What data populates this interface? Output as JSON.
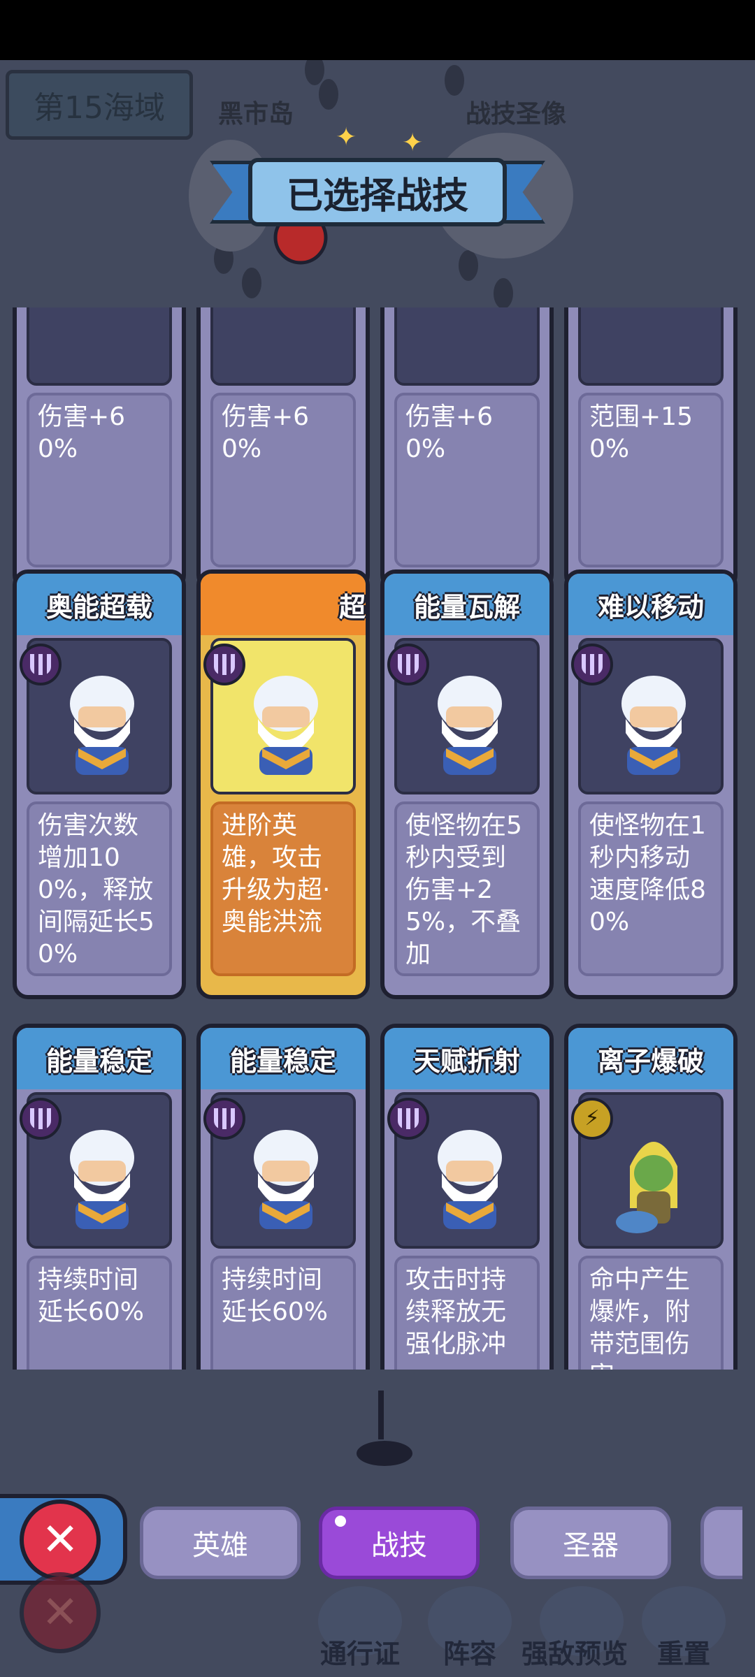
{
  "map": {
    "sea_label": "第15海域",
    "island_left": "黑市岛",
    "island_right": "战技圣像"
  },
  "dialog": {
    "title": "已选择战技"
  },
  "cards": [
    {
      "title": "",
      "desc": "伤害+60%",
      "badge": "none",
      "state": "normal"
    },
    {
      "title": "",
      "desc": "伤害+60%",
      "badge": "none",
      "state": "normal"
    },
    {
      "title": "",
      "desc": "伤害+60%",
      "badge": "none",
      "state": "normal"
    },
    {
      "title": "",
      "desc": "范围+150%",
      "badge": "none",
      "state": "normal"
    },
    {
      "title": "奥能超载",
      "desc": "伤害次数增加100%，释放间隔延长50%",
      "badge": "purple",
      "state": "normal"
    },
    {
      "title": "超",
      "desc": "进阶英雄，攻击升级为超·奥能洪流",
      "badge": "purple",
      "state": "selected"
    },
    {
      "title": "能量瓦解",
      "desc": "使怪物在5秒内受到伤害+25%，不叠加",
      "badge": "purple",
      "state": "normal"
    },
    {
      "title": "难以移动",
      "desc": "使怪物在1秒内移动速度降低80%",
      "badge": "purple",
      "state": "normal"
    },
    {
      "title": "能量稳定",
      "desc": "持续时间延长60%",
      "badge": "purple",
      "state": "normal"
    },
    {
      "title": "能量稳定",
      "desc": "持续时间延长60%",
      "badge": "purple",
      "state": "normal"
    },
    {
      "title": "天赋折射",
      "desc": "攻击时持续释放无强化脉冲",
      "badge": "purple",
      "state": "normal"
    },
    {
      "title": "离子爆破",
      "desc": "命中产生爆炸，附带范围伤害",
      "badge": "gold",
      "state": "normal"
    }
  ],
  "tabs": {
    "hero": "英雄",
    "skill": "战技",
    "artifact": "圣器"
  },
  "bottom_nav": {
    "pass": "通行证",
    "lineup": "阵容",
    "enemy_preview": "强敌预览",
    "reset": "重置"
  },
  "colors": {
    "card_purple": "#8e8bb8",
    "header_blue": "#4b97d4",
    "selected_orange": "#f08a2c",
    "tab_active": "#9a4ad8",
    "close_red": "#e2344c"
  }
}
